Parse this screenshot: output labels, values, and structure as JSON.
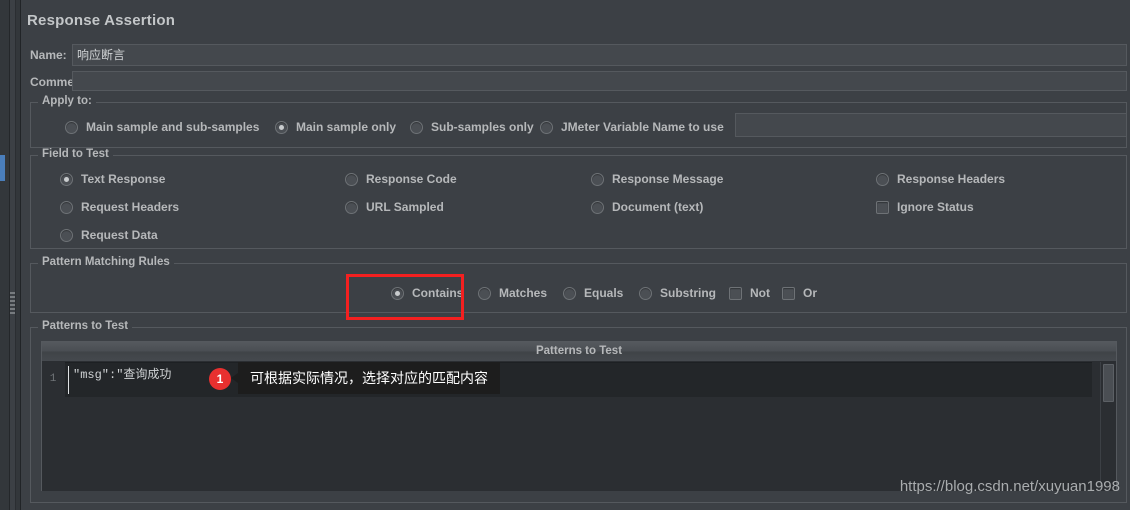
{
  "panel": {
    "title": "Response Assertion"
  },
  "fields": {
    "name_label": "Name:",
    "name_value": "响应断言",
    "comments_label": "Comments:",
    "comments_value": "",
    "variable_value": ""
  },
  "apply_to": {
    "legend": "Apply to:",
    "options": [
      {
        "label": "Main sample and sub-samples",
        "selected": false
      },
      {
        "label": "Main sample only",
        "selected": true
      },
      {
        "label": "Sub-samples only",
        "selected": false
      },
      {
        "label": "JMeter Variable Name to use",
        "selected": false
      }
    ]
  },
  "field_to_test": {
    "legend": "Field to Test",
    "options": [
      {
        "label": "Text Response",
        "selected": true
      },
      {
        "label": "Response Code",
        "selected": false
      },
      {
        "label": "Response Message",
        "selected": false
      },
      {
        "label": "Response Headers",
        "selected": false
      },
      {
        "label": "Request Headers",
        "selected": false
      },
      {
        "label": "URL Sampled",
        "selected": false
      },
      {
        "label": "Document (text)",
        "selected": false
      },
      {
        "label": "Request Data",
        "selected": false
      }
    ],
    "checkbox": {
      "label": "Ignore Status",
      "checked": false
    }
  },
  "pattern_rules": {
    "legend": "Pattern Matching Rules",
    "radios": [
      {
        "label": "Contains",
        "selected": true
      },
      {
        "label": "Matches",
        "selected": false
      },
      {
        "label": "Equals",
        "selected": false
      },
      {
        "label": "Substring",
        "selected": false
      }
    ],
    "checkboxes": [
      {
        "label": "Not",
        "checked": false
      },
      {
        "label": "Or",
        "checked": false
      }
    ]
  },
  "patterns": {
    "legend": "Patterns to Test",
    "column_header": "Patterns to Test",
    "rows": [
      {
        "num": "1",
        "value": "\"msg\":\"查询成功"
      }
    ]
  },
  "annotation": {
    "badge": "1",
    "text": "可根据实际情况，选择对应的匹配内容",
    "highlight_color": "#f42020",
    "badge_color": "#e8302f"
  },
  "watermark": "https://blog.csdn.net/xuyuan1998"
}
